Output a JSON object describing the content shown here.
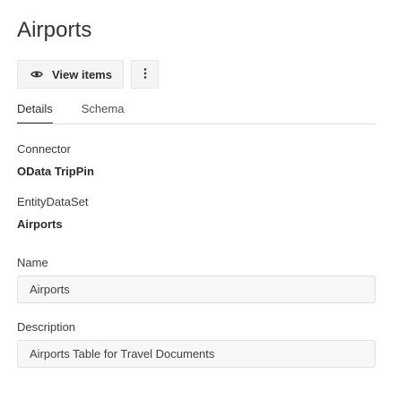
{
  "page": {
    "title": "Airports"
  },
  "toolbar": {
    "view_items_label": "View items",
    "view_items_icon": "eye-icon",
    "more_icon": "more-vertical-icon"
  },
  "tabs": [
    {
      "label": "Details",
      "active": true
    },
    {
      "label": "Schema",
      "active": false
    }
  ],
  "details": {
    "connector_label": "Connector",
    "connector_value": "OData TripPin",
    "entity_label": "EntityDataSet",
    "entity_value": "Airports",
    "name_label": "Name",
    "name_value": "Airports",
    "description_label": "Description",
    "description_value": "Airports Table for Travel Documents"
  }
}
